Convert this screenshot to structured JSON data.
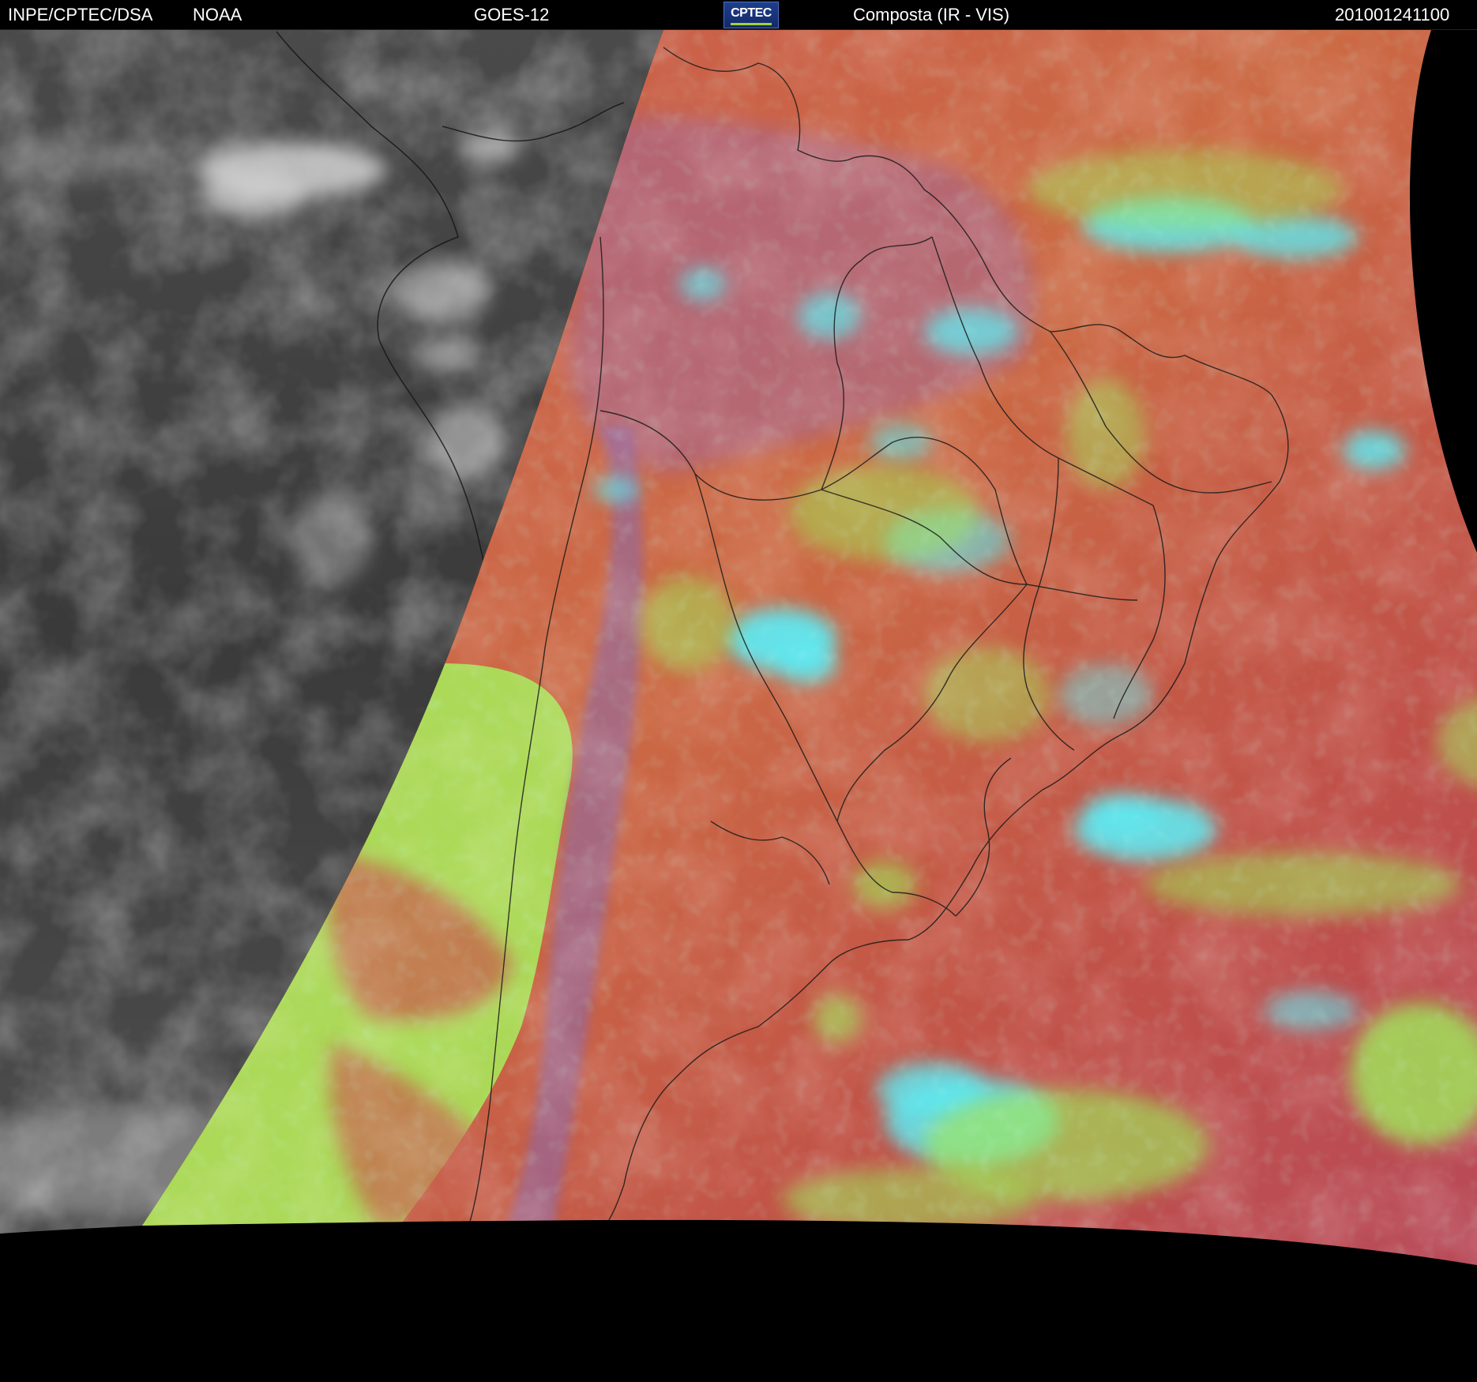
{
  "header": {
    "agency": "INPE/CPTEC/DSA",
    "source": "NOAA",
    "satellite": "GOES-12",
    "logo_text": "CPTEC",
    "product": "Composta (IR - VIS)",
    "timestamp": "201001241100"
  },
  "colors": {
    "background": "#000000",
    "night_ir_gray": "#3f3f3f",
    "land_red": "#c0524a",
    "ocean_orange": "#cf7a45",
    "cloud_cyan": "#5fe8f0",
    "cloud_green": "#9fe85a",
    "boundary_line": "#1a1a1a"
  },
  "image": {
    "description_icon": "satellite-composite-icon"
  }
}
